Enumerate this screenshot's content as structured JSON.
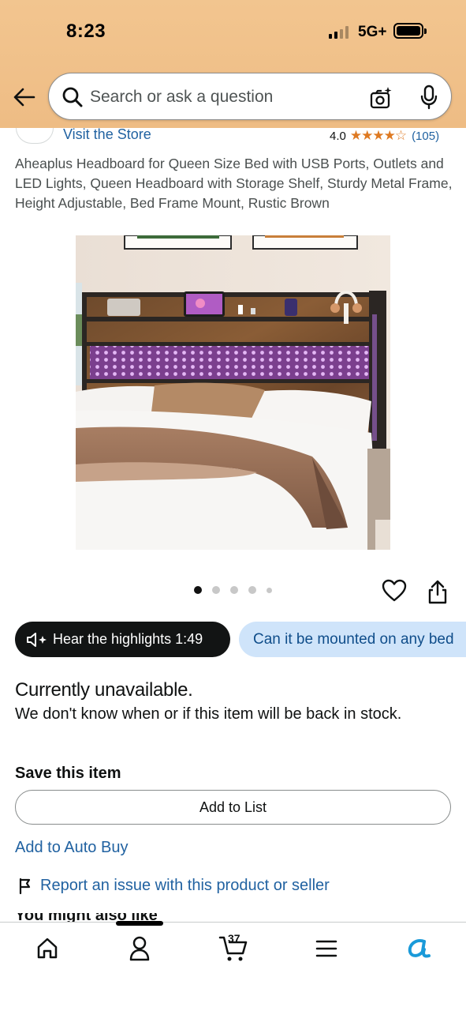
{
  "status_bar": {
    "time": "8:23",
    "network": "5G+"
  },
  "search": {
    "placeholder": "Search or ask a question"
  },
  "store": {
    "link_text": "Visit the Store",
    "rating": "4.0",
    "stars": "★★★★☆",
    "rating_count": "(105)"
  },
  "product": {
    "title": "Aheaplus Headboard for Queen Size Bed with USB Ports, Outlets and LED Lights, Queen Headboard with Storage Shelf, Sturdy Metal Frame, Height Adjustable, Bed Frame Mount, Rustic Brown",
    "image_count": 5,
    "active_image_index": 0
  },
  "pills": {
    "hear_highlights": "Hear the highlights 1:49",
    "question": "Can it be mounted on any bed"
  },
  "availability": {
    "title": "Currently unavailable.",
    "message": "We don't know when or if this item will be back in stock."
  },
  "save": {
    "title": "Save this item",
    "add_to_list": "Add to List",
    "auto_buy": "Add to Auto Buy",
    "report": "Report an issue with this product or seller"
  },
  "next_section_partial": "You might also like",
  "bottom_nav": {
    "cart_count": "37",
    "items": [
      "home-icon",
      "account-icon",
      "cart-icon",
      "menu-icon",
      "rufus-icon"
    ]
  },
  "colors": {
    "header_bg": "#f0c089",
    "link": "#2162a1",
    "star": "#de7921",
    "pill_dark": "#121414",
    "pill_light": "#cfe4fa"
  }
}
